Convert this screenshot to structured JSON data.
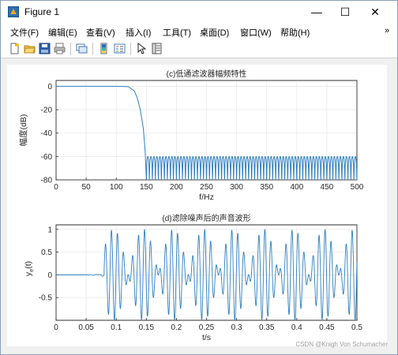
{
  "window": {
    "title": "Figure 1",
    "buttons": {
      "minimize": "—",
      "maximize": "☐",
      "close": "✕"
    }
  },
  "menubar": {
    "items": [
      "文件(F)",
      "编辑(E)",
      "查看(V)",
      "插入(I)",
      "工具(T)",
      "桌面(D)",
      "窗口(W)",
      "帮助(H)"
    ],
    "more": "»"
  },
  "toolbar": {
    "tools": [
      "new-figure-icon",
      "open-icon",
      "save-icon",
      "print-icon",
      "link-icon",
      "colorbar-icon",
      "legend-icon",
      "pointer-icon",
      "property-inspector-icon"
    ]
  },
  "colors": {
    "line": "#2e7fc0",
    "axes": "#262626",
    "grid": "#e6e6e6"
  },
  "chart_data": [
    {
      "type": "line",
      "title": "(c)低通滤波器幅频特性",
      "xlabel": "f/Hz",
      "ylabel": "幅度(dB)",
      "xlim": [
        0,
        500
      ],
      "ylim": [
        -80,
        5
      ],
      "xticks": [
        "0",
        "50",
        "100",
        "150",
        "200",
        "250",
        "300",
        "350",
        "400",
        "450",
        "500"
      ],
      "yticks": [
        "0",
        "-20",
        "-40",
        "-60",
        "-80"
      ],
      "grid": true,
      "description_points": {
        "x": [
          0,
          100,
          120,
          130,
          135,
          140,
          145,
          148,
          150
        ],
        "y": [
          0,
          0,
          -0.3,
          -4,
          -10,
          -20,
          -36,
          -55,
          -80
        ]
      },
      "stopband": {
        "start": 150,
        "end": 500,
        "ripple_top": -60,
        "lobe_spacing": 5
      }
    },
    {
      "type": "line",
      "title": "(d)滤除噪声后的声音波形",
      "xlabel": "t/s",
      "ylabel": "y",
      "ylabel_sub": "e",
      "ylabel_tail": "(t)",
      "xlim": [
        0,
        0.5
      ],
      "ylim": [
        -1,
        1.1
      ],
      "xticks": [
        "0",
        "0.05",
        "0.1",
        "0.15",
        "0.2",
        "0.25",
        "0.3",
        "0.35",
        "0.4",
        "0.45",
        "0.5"
      ],
      "yticks": [
        "1",
        "0.5",
        "0",
        "-0.5"
      ],
      "grid": true,
      "signal": {
        "onset": 0.08,
        "flat_until": 0.055,
        "freqs_hz": [
          90,
          110
        ],
        "amplitude": 0.5
      }
    }
  ],
  "watermark": "CSDN @Knigh Von Schumacher"
}
